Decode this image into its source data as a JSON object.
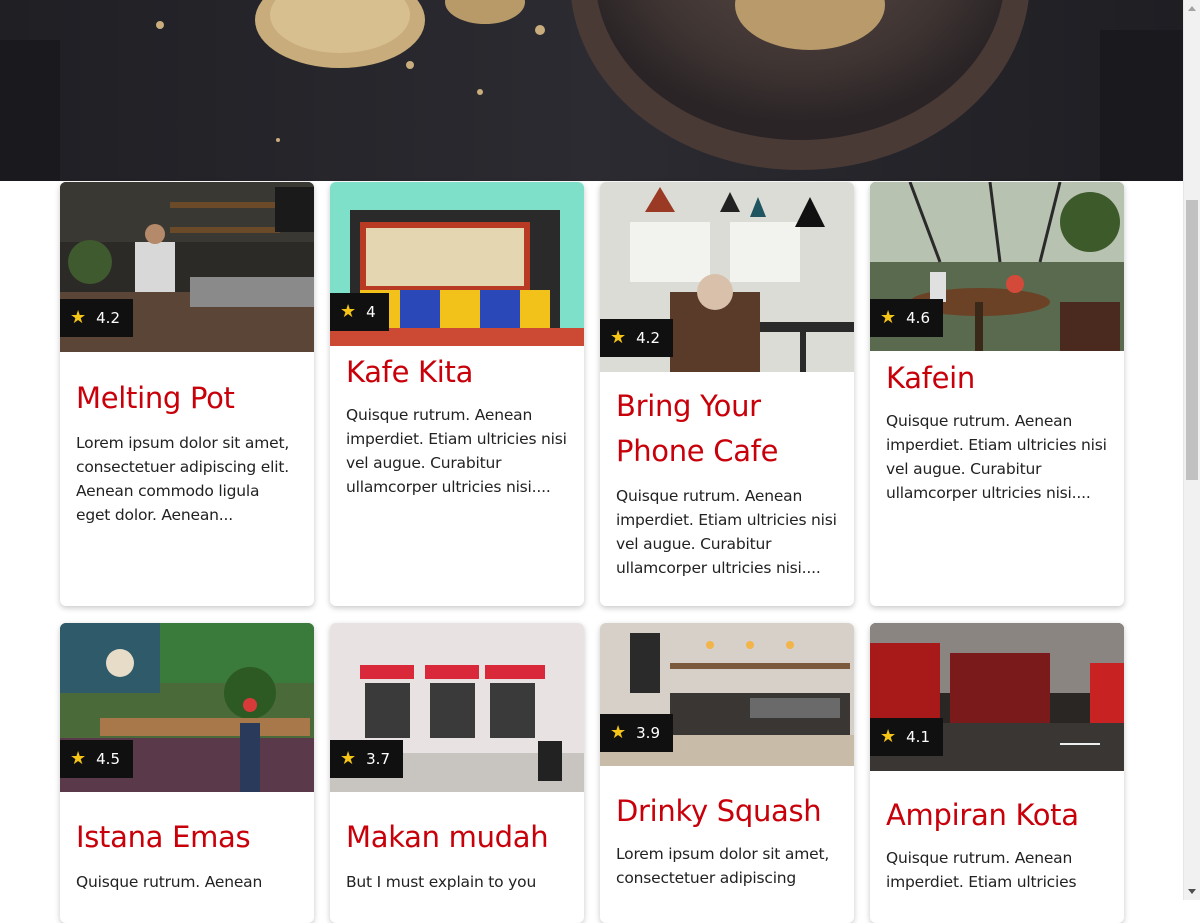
{
  "cafes": [
    {
      "name": "Melting Pot",
      "rating": "4.2",
      "description": "Lorem ipsum dolor sit amet, consectetuer adipiscing elit. Aenean commodo ligula eget dolor. Aenean..."
    },
    {
      "name": "Kafe Kita",
      "rating": "4",
      "description": "Quisque rutrum. Aenean imperdiet. Etiam ultricies nisi vel augue. Curabitur ullamcorper ultricies nisi...."
    },
    {
      "name": "Bring Your Phone Cafe",
      "rating": "4.2",
      "description": "Quisque rutrum. Aenean imperdiet. Etiam ultricies nisi vel augue. Curabitur ullamcorper ultricies nisi...."
    },
    {
      "name": "Kafein",
      "rating": "4.6",
      "description": "Quisque rutrum. Aenean imperdiet. Etiam ultricies nisi vel augue. Curabitur ullamcorper ultricies nisi...."
    },
    {
      "name": "Istana Emas",
      "rating": "4.5",
      "description": "Quisque rutrum. Aenean"
    },
    {
      "name": "Makan mudah",
      "rating": "3.7",
      "description": "But I must explain to you"
    },
    {
      "name": "Drinky Squash",
      "rating": "3.9",
      "description": "Lorem ipsum dolor sit amet, consectetuer adipiscing"
    },
    {
      "name": "Ampiran Kota",
      "rating": "4.1",
      "description": "Quisque rutrum. Aenean imperdiet. Etiam ultricies"
    }
  ],
  "colors": {
    "title": "#c8000a",
    "star": "#f5c518",
    "rating_bg": "#101010"
  },
  "icons": {
    "rating": "star-icon"
  },
  "star_glyph": "★"
}
